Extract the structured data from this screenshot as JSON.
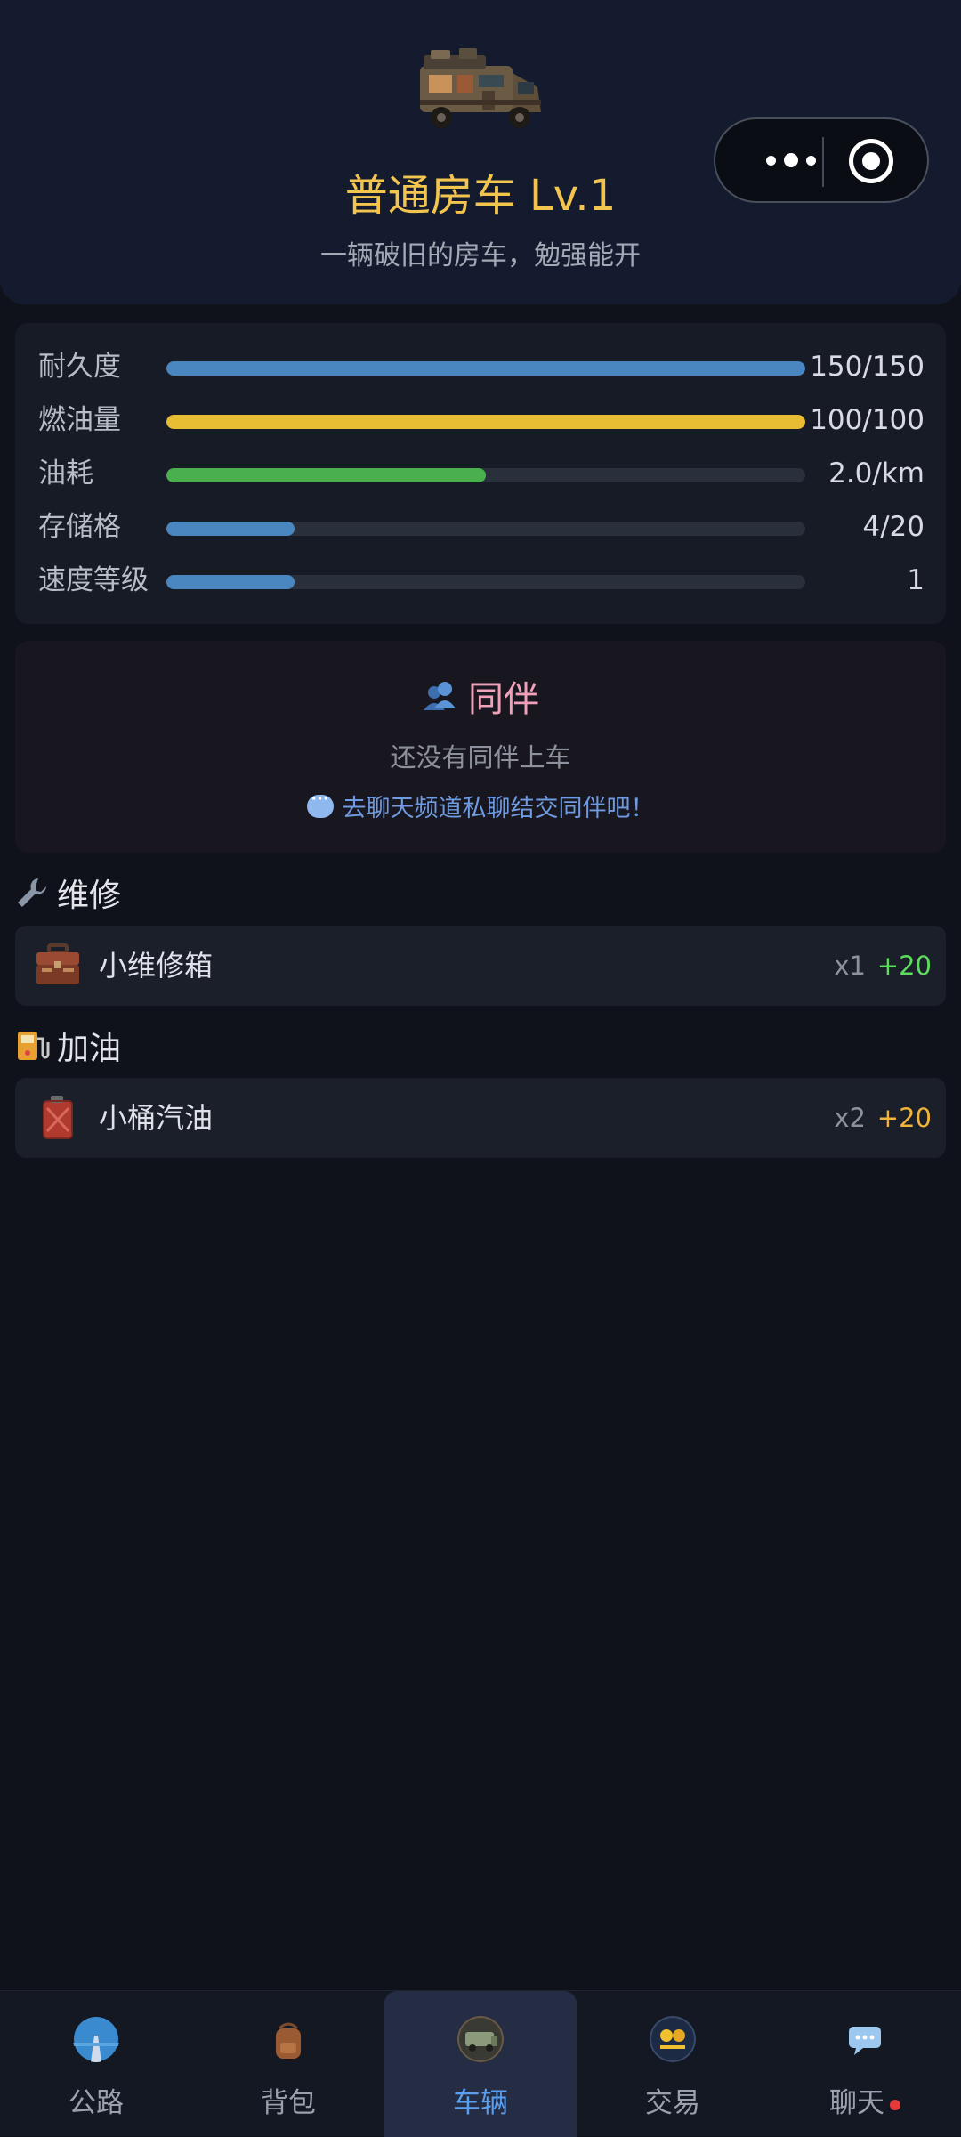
{
  "vehicle": {
    "title": "普通房车 Lv.1",
    "description": "一辆破旧的房车，勉强能开"
  },
  "stats": [
    {
      "label": "耐久度",
      "value": "150/150",
      "fill": 1.0,
      "color": "#4a86c0"
    },
    {
      "label": "燃油量",
      "value": "100/100",
      "fill": 1.0,
      "color": "#e8bd34"
    },
    {
      "label": "油耗",
      "value": "2.0/km",
      "fill": 0.5,
      "color": "#4ab04e"
    },
    {
      "label": "存储格",
      "value": "4/20",
      "fill": 0.2,
      "color": "#4a86c0"
    },
    {
      "label": "速度等级",
      "value": "1",
      "fill": 0.2,
      "color": "#4a86c0"
    }
  ],
  "companion": {
    "title": "同伴",
    "empty_text": "还没有同伴上车",
    "hint": "去聊天频道私聊结交同伴吧！"
  },
  "repair": {
    "title": "维修",
    "item": {
      "name": "小维修箱",
      "qty": "x1",
      "bonus": "+20",
      "bonus_color": "#5ddc5d"
    }
  },
  "refuel": {
    "title": "加油",
    "item": {
      "name": "小桶汽油",
      "qty": "x2",
      "bonus": "+20",
      "bonus_color": "#f0b43a"
    }
  },
  "tabs": [
    {
      "label": "公路",
      "icon": "road-icon"
    },
    {
      "label": "背包",
      "icon": "backpack-icon"
    },
    {
      "label": "车辆",
      "icon": "vehicle-icon",
      "active": true
    },
    {
      "label": "交易",
      "icon": "trade-icon"
    },
    {
      "label": "聊天",
      "icon": "chat-icon",
      "badge": true
    }
  ]
}
